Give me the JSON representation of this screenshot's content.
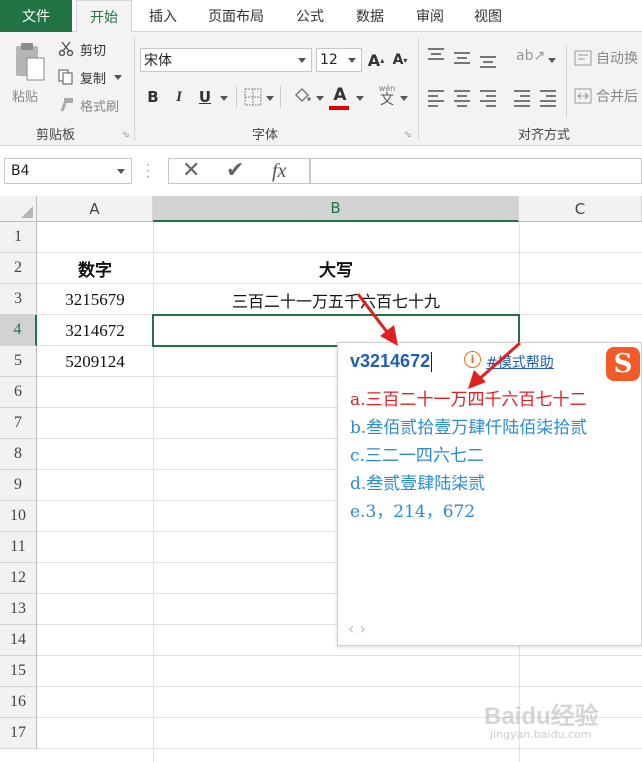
{
  "tabs": {
    "file": "文件",
    "home": "开始",
    "insert": "插入",
    "layout": "页面布局",
    "formulas": "公式",
    "data": "数据",
    "review": "审阅",
    "view": "视图"
  },
  "clipboard": {
    "paste": "粘贴",
    "cut": "剪切",
    "copy": "复制",
    "format_painter": "格式刷",
    "group_label": "剪贴板"
  },
  "font": {
    "name": "宋体",
    "size": "12",
    "bold": "B",
    "italic": "I",
    "underline": "U",
    "font_color_glyph": "A",
    "phonetic_glyph": "wén",
    "grow_glyph": "A",
    "shrink_glyph": "A",
    "group_label": "字体",
    "font_color": "#e00000"
  },
  "alignment": {
    "wrap_text": "自动换",
    "merge": "合并后",
    "group_label": "对齐方式"
  },
  "formula_bar": {
    "name_box": "B4",
    "fx": "fx",
    "formula": ""
  },
  "sheet": {
    "columns": [
      "A",
      "B",
      "C"
    ],
    "rows": [
      "1",
      "2",
      "3",
      "4",
      "5",
      "6",
      "7",
      "8",
      "9",
      "10",
      "11",
      "12",
      "13",
      "14",
      "15",
      "16",
      "17"
    ],
    "header_a": "数字",
    "header_b": "大写",
    "a3": "3215679",
    "b3": "三百二十一万五千六百七十九",
    "a4": "3214672",
    "a5": "5209124",
    "active_cell": "B4"
  },
  "ime": {
    "input": "v3214672",
    "help_label": "模式帮助",
    "candidates": [
      {
        "label": "a.",
        "text": "三百二十一万四千六百七十二"
      },
      {
        "label": "b.",
        "text": "叁佰贰拾壹万肆仟陆佰柒拾贰"
      },
      {
        "label": "c.",
        "text": "三二一四六七二"
      },
      {
        "label": "d.",
        "text": "叁贰壹肆陆柒贰"
      },
      {
        "label": "e.",
        "text": "3，214，672"
      }
    ],
    "nav": "‹ ›",
    "selected_color": "#e02020",
    "candidate_color": "#2a8bd0"
  },
  "watermark": {
    "text": "Baidu经验",
    "sub": "jingyan.baidu.com"
  },
  "colors": {
    "excel_green": "#217346",
    "arrow_red": "#e0201c"
  }
}
